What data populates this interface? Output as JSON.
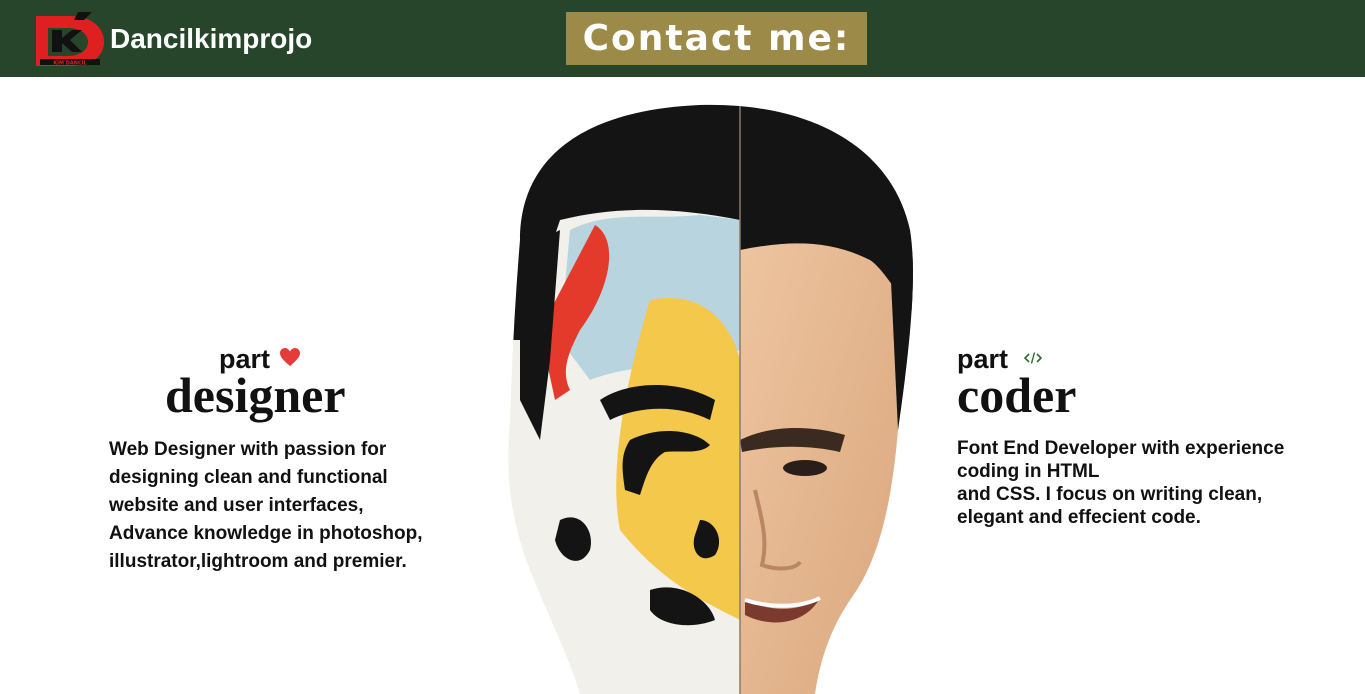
{
  "header": {
    "brand": "Dancilkimprojo",
    "contact_label": "Contact me:",
    "logo_icon": "dk-logo-icon",
    "colors": {
      "bar": "#26452a",
      "button": "#9c8a49",
      "logo_red": "#e02020"
    }
  },
  "designer": {
    "part_label": "part",
    "icon": "heart-icon",
    "title": "designer",
    "desc_lines": [
      "Web Designer with passion for",
      "designing clean and functional",
      "website and user interfaces,",
      "Advance knowledge in photoshop,",
      "illustrator,lightroom and premier."
    ]
  },
  "coder": {
    "part_label": "part",
    "icon": "code-icon",
    "title": "coder",
    "desc_lines": [
      "Font End Developer with experience",
      "coding in HTML",
      "and CSS. I focus on writing clean,",
      "elegant and effecient code."
    ]
  },
  "portrait": {
    "icon": "half-painted-face-portrait"
  }
}
